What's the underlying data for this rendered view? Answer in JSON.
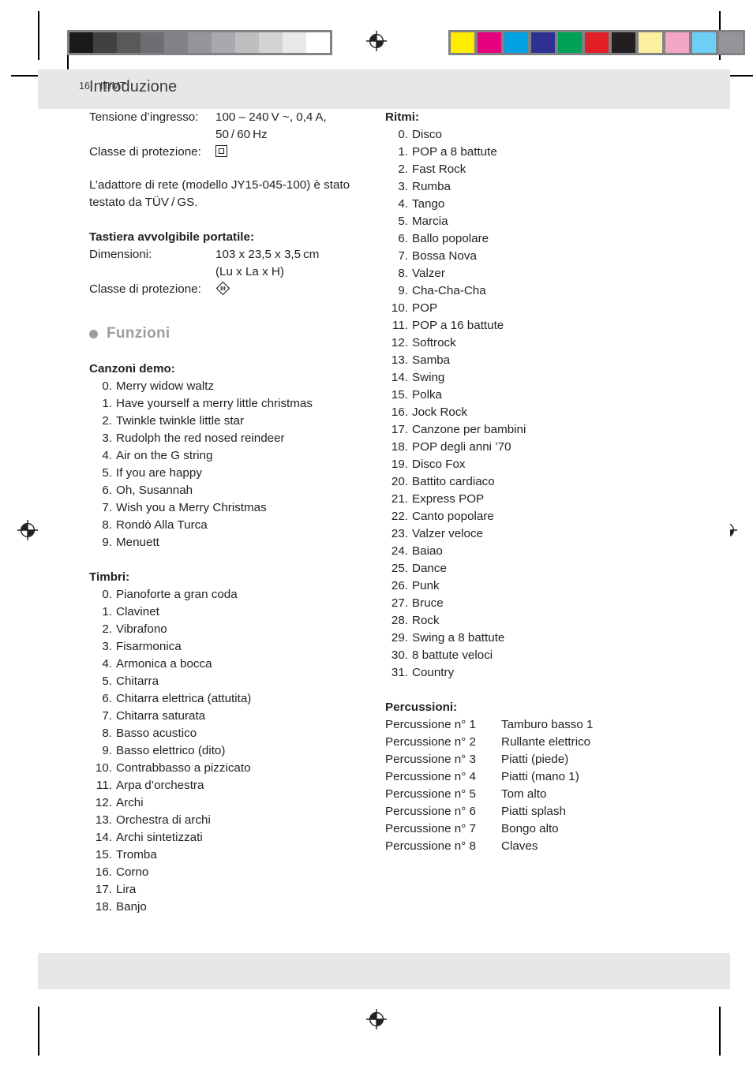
{
  "header": {
    "title": "Introduzione"
  },
  "footer": {
    "page_number": "16",
    "locale": "IT/MT"
  },
  "specs": {
    "input_voltage_label": "Tensione d’ingresso:",
    "input_voltage_line1": "100 – 240 V ~, 0,4 A,",
    "input_voltage_line2": "50 / 60 Hz",
    "protection_class_label": "Classe di protezione:",
    "protection_class_symbol": "class-2-double-insulation-square",
    "adapter_note": "L’adattore di rete (modello JY15-045-100) è stato testato da TÜV / GS."
  },
  "keyboard": {
    "heading": "Tastiera avvolgibile portatile:",
    "dimensions_label": "Dimensioni:",
    "dimensions_line1": "103 x 23,5 x 3,5 cm",
    "dimensions_line2": "(Lu x La x H)",
    "protection_class_label": "Classe di protezione:",
    "protection_class_symbol": "class-3-diamond-III"
  },
  "functions_section": {
    "title": "Funzioni",
    "bullet": "bullet-dot"
  },
  "demo_songs": {
    "heading": "Canzoni demo:",
    "items": [
      {
        "num": "0.",
        "name": "Merry widow waltz"
      },
      {
        "num": "1.",
        "name": "Have yourself a merry little christmas"
      },
      {
        "num": "2.",
        "name": "Twinkle twinkle little star"
      },
      {
        "num": "3.",
        "name": "Rudolph the red nosed reindeer"
      },
      {
        "num": "4.",
        "name": "Air on the G string"
      },
      {
        "num": "5.",
        "name": "If you are happy"
      },
      {
        "num": "6.",
        "name": "Oh, Susannah"
      },
      {
        "num": "7.",
        "name": "Wish you a Merry Christmas"
      },
      {
        "num": "8.",
        "name": "Rondò Alla Turca"
      },
      {
        "num": "9.",
        "name": "Menuett"
      }
    ]
  },
  "timbres": {
    "heading": "Timbri:",
    "items": [
      {
        "num": "0.",
        "name": "Pianoforte a gran coda"
      },
      {
        "num": "1.",
        "name": "Clavinet"
      },
      {
        "num": "2.",
        "name": "Vibrafono"
      },
      {
        "num": "3.",
        "name": "Fisarmonica"
      },
      {
        "num": "4.",
        "name": "Armonica a bocca"
      },
      {
        "num": "5.",
        "name": "Chitarra"
      },
      {
        "num": "6.",
        "name": "Chitarra elettrica (attutita)"
      },
      {
        "num": "7.",
        "name": "Chitarra saturata"
      },
      {
        "num": "8.",
        "name": "Basso acustico"
      },
      {
        "num": "9.",
        "name": "Basso elettrico (dito)"
      },
      {
        "num": "10.",
        "name": "Contrabbasso a pizzicato"
      },
      {
        "num": "11.",
        "name": "Arpa d’orchestra"
      },
      {
        "num": "12.",
        "name": "Archi"
      },
      {
        "num": "13.",
        "name": "Orchestra di archi"
      },
      {
        "num": "14.",
        "name": "Archi sintetizzati"
      },
      {
        "num": "15.",
        "name": "Tromba"
      },
      {
        "num": "16.",
        "name": "Corno"
      },
      {
        "num": "17.",
        "name": "Lira"
      },
      {
        "num": "18.",
        "name": "Banjo"
      }
    ]
  },
  "rhythms": {
    "heading": "Ritmi:",
    "items": [
      {
        "num": "0.",
        "name": "Disco"
      },
      {
        "num": "1.",
        "name": "POP a 8 battute"
      },
      {
        "num": "2.",
        "name": "Fast Rock"
      },
      {
        "num": "3.",
        "name": "Rumba"
      },
      {
        "num": "4.",
        "name": "Tango"
      },
      {
        "num": "5.",
        "name": "Marcia"
      },
      {
        "num": "6.",
        "name": "Ballo popolare"
      },
      {
        "num": "7.",
        "name": "Bossa Nova"
      },
      {
        "num": "8.",
        "name": "Valzer"
      },
      {
        "num": "9.",
        "name": "Cha-Cha-Cha"
      },
      {
        "num": "10.",
        "name": "POP"
      },
      {
        "num": "11.",
        "name": "POP a 16 battute"
      },
      {
        "num": "12.",
        "name": "Softrock"
      },
      {
        "num": "13.",
        "name": "Samba"
      },
      {
        "num": "14.",
        "name": "Swing"
      },
      {
        "num": "15.",
        "name": "Polka"
      },
      {
        "num": "16.",
        "name": "Jock Rock"
      },
      {
        "num": "17.",
        "name": "Canzone per bambini"
      },
      {
        "num": "18.",
        "name": "POP degli anni ’70"
      },
      {
        "num": "19.",
        "name": "Disco Fox"
      },
      {
        "num": "20.",
        "name": "Battito cardiaco"
      },
      {
        "num": "21.",
        "name": "Express POP"
      },
      {
        "num": "22.",
        "name": "Canto popolare"
      },
      {
        "num": "23.",
        "name": "Valzer veloce"
      },
      {
        "num": "24.",
        "name": "Baiao"
      },
      {
        "num": "25.",
        "name": "Dance"
      },
      {
        "num": "26.",
        "name": "Punk"
      },
      {
        "num": "27.",
        "name": "Bruce"
      },
      {
        "num": "28.",
        "name": "Rock"
      },
      {
        "num": "29.",
        "name": "Swing a 8 battute"
      },
      {
        "num": "30.",
        "name": "8 battute veloci"
      },
      {
        "num": "31.",
        "name": "Country"
      }
    ]
  },
  "percussion": {
    "heading": "Percussioni:",
    "items": [
      {
        "label": "Percussione n° 1",
        "name": "Tamburo basso 1"
      },
      {
        "label": "Percussione n° 2",
        "name": "Rullante elettrico"
      },
      {
        "label": "Percussione n° 3",
        "name": "Piatti (piede)"
      },
      {
        "label": "Percussione n° 4",
        "name": "Piatti (mano 1)"
      },
      {
        "label": "Percussione n° 5",
        "name": "Tom alto"
      },
      {
        "label": "Percussione n° 6",
        "name": "Piatti splash"
      },
      {
        "label": "Percussione n° 7",
        "name": "Bongo alto"
      },
      {
        "label": "Percussione n° 8",
        "name": "Claves"
      }
    ]
  },
  "print_marks": {
    "registration_mark": "registration-target-icon",
    "grayscale_wedge": [
      "#1a1a1a",
      "#414042",
      "#58595b",
      "#6d6e71",
      "#808285",
      "#939598",
      "#a7a9ac",
      "#bcbec0",
      "#d1d3d4",
      "#e8e9ea",
      "#ffffff"
    ],
    "color_bar": [
      "#ffec00",
      "#e5007e",
      "#00a0e3",
      "#2e3192",
      "#00a157",
      "#e21f26",
      "#231f20",
      "#fbf0a0",
      "#f4a7c4",
      "#6dcff6",
      "#939598"
    ]
  }
}
